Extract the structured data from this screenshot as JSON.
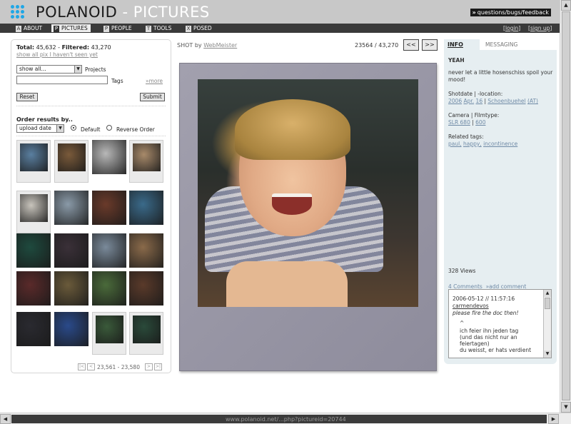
{
  "header": {
    "logo_main": "POLANOID",
    "logo_sub": "- PICTURES",
    "feedback_prefix": "»",
    "feedback_label": "questions/bugs/feedback"
  },
  "nav": {
    "items": [
      {
        "key": "A",
        "label": "ABOUT"
      },
      {
        "key": "P",
        "label": "PICTURES",
        "active": true
      },
      {
        "key": "P",
        "label": "PEOPLE"
      },
      {
        "key": "T",
        "label": "TOOLS"
      },
      {
        "key": "X",
        "label": "POSED"
      }
    ],
    "login": "login",
    "signup": "sign up"
  },
  "filter": {
    "total_label": "Total:",
    "total": "45,632",
    "filtered_label": "Filtered:",
    "filtered": "43,270",
    "show_unseen": "show all pix I haven't seen yet",
    "show_select": "show all...",
    "projects_label": "Projects",
    "tags_label": "Tags",
    "more_link": "»more",
    "reset": "Reset",
    "submit": "Submit",
    "order_label": "Order results by..",
    "order_select": "upload date",
    "order_default": "Default",
    "order_reverse": "Reverse Order",
    "pager_range": "23,561 - 23,580",
    "pager_first": "|<",
    "pager_prev": "<",
    "pager_next": ">",
    "pager_last": ">|"
  },
  "thumbnails": [
    {
      "style": "pola",
      "color": "#5a7fa0"
    },
    {
      "style": "pola",
      "color": "#7a5a3a"
    },
    {
      "style": "plain",
      "color": "#b8b8b8"
    },
    {
      "style": "pola",
      "color": "#a88a6a"
    },
    {
      "style": "pola",
      "color": "#c8c4bc"
    },
    {
      "style": "plain",
      "color": "#8a9aa8"
    },
    {
      "style": "plain",
      "color": "#6a3a2a"
    },
    {
      "style": "plain",
      "color": "#3a6a8a"
    },
    {
      "style": "plain",
      "color": "#1e4a3e"
    },
    {
      "style": "plain",
      "color": "#3a3038"
    },
    {
      "style": "plain",
      "color": "#7a8a9a"
    },
    {
      "style": "plain",
      "color": "#8a6a4a"
    },
    {
      "style": "plain",
      "color": "#5a2a2a"
    },
    {
      "style": "plain",
      "color": "#6a5a3a"
    },
    {
      "style": "plain",
      "color": "#4a6a3a"
    },
    {
      "style": "plain",
      "color": "#5a3a2a"
    },
    {
      "style": "plain",
      "color": "#2a2a30"
    },
    {
      "style": "plain",
      "color": "#2a4a8a"
    },
    {
      "style": "pola",
      "color": "#3a5a3a"
    },
    {
      "style": "pola",
      "color": "#2a4a3a"
    }
  ],
  "shot": {
    "by_label": "SHOT by",
    "author": "WebMeister",
    "counter": "23564 / 43,270",
    "prev": "<<",
    "next": ">>"
  },
  "info": {
    "tab_info": "INFO",
    "tab_messaging": "MESSAGING",
    "title": "YEAH",
    "caption": "never let a little hosenschiss spoil your mood!",
    "shotdate_label": "Shotdate | -location:",
    "year": "2006",
    "month": "Apr.",
    "day": "16",
    "location": "Schoenbuehel",
    "country": "(AT)",
    "camera_label": "Camera | Filmtype:",
    "camera": "SLR 680",
    "film": "600",
    "related_label": "Related tags:",
    "tags": [
      "paul,",
      "happy,",
      "incontinence"
    ],
    "views": "328",
    "views_label": "Views",
    "comments_link": "4 Comments",
    "add_comment": "»add comment"
  },
  "comment": {
    "date": "2006-05-12 // 11:57:16",
    "author": "carmendevos",
    "text": "please fire the doc then!",
    "caret": "^",
    "reply_lines": [
      "ich feier ihn jeden tag",
      "(und das nicht nur an",
      "feiertagen)",
      "du weisst, er hats verdient"
    ]
  },
  "status": {
    "url": "www.polanoid.net/...php?pictureid=20744"
  }
}
